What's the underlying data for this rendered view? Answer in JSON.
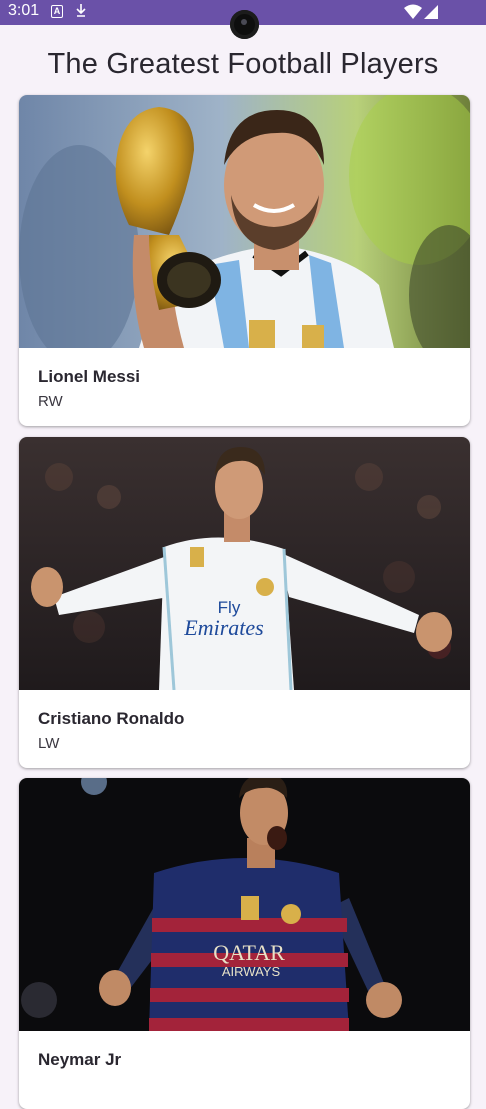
{
  "status_bar": {
    "time": "3:01",
    "icons": [
      "a-notification-icon",
      "download-icon",
      "camera-cutout",
      "wifi-icon",
      "signal-icon"
    ]
  },
  "app": {
    "title": "The Greatest Football Players"
  },
  "players": [
    {
      "name": "Lionel Messi",
      "position": "RW",
      "image": "messi-holding-trophy-photo"
    },
    {
      "name": "Cristiano Ronaldo",
      "position": "LW",
      "image": "ronaldo-celebrating-photo"
    },
    {
      "name": "Neymar Jr",
      "position": "",
      "image": "neymar-shouting-photo"
    }
  ],
  "photo_text": {
    "sponsor_1": "Fly",
    "sponsor_2": "Emirates",
    "sponsor_3": "QATAR",
    "sponsor_4": "AIRWAYS"
  },
  "colors": {
    "status_bar": "#6a51a8",
    "background": "#f7f2f9",
    "card": "#ffffff",
    "text": "#2a2730"
  }
}
